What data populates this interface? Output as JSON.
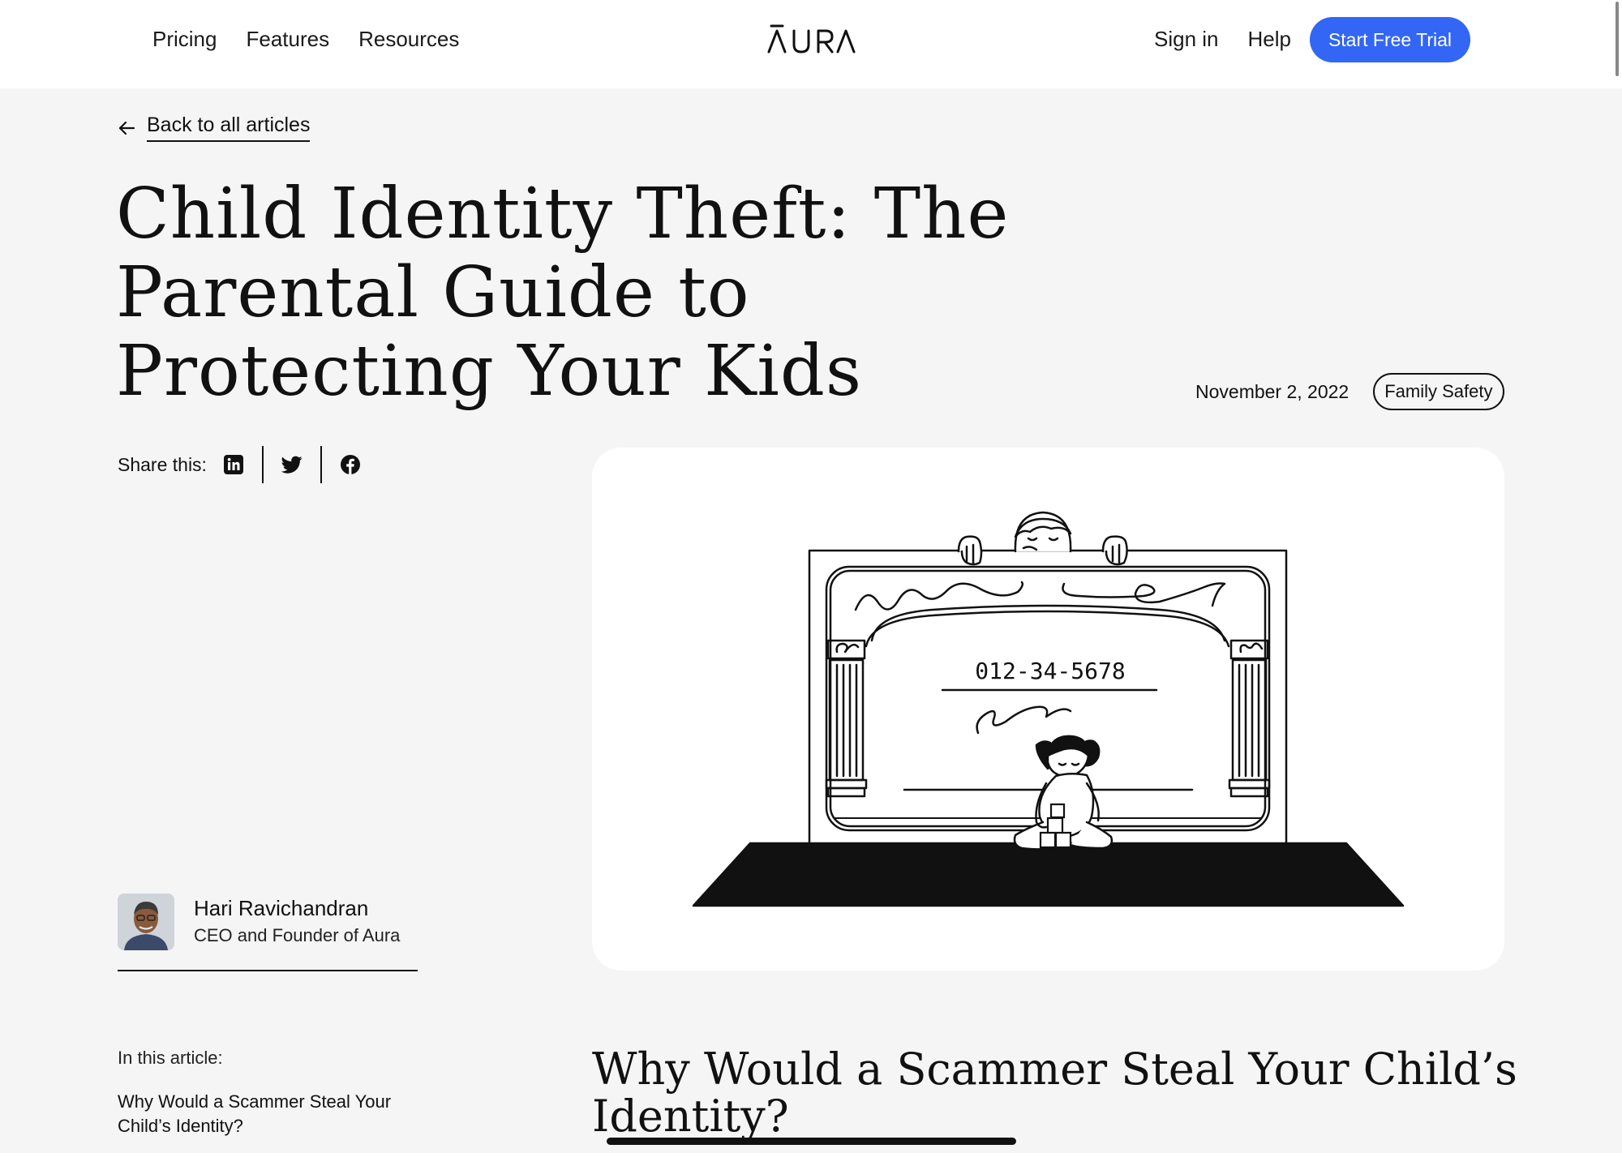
{
  "header": {
    "nav_left": [
      "Pricing",
      "Features",
      "Resources"
    ],
    "logo_text": "AURA",
    "nav_right": [
      "Sign in",
      "Help"
    ],
    "cta_label": "Start Free Trial"
  },
  "back_link": {
    "label": "Back to all articles"
  },
  "article": {
    "title": "Child Identity Theft: The Parental Guide to Protecting Your Kids",
    "date": "November 2, 2022",
    "tag": "Family Safety"
  },
  "share": {
    "label": "Share this:",
    "icons": [
      "linkedin-icon",
      "twitter-icon",
      "facebook-icon"
    ]
  },
  "hero": {
    "card_number": "012-34-5678"
  },
  "author": {
    "name": "Hari Ravichandran",
    "role": "CEO and Founder of Aura"
  },
  "toc": {
    "label": "In this article:",
    "items": [
      "Why Would a Scammer Steal Your Child’s Identity?"
    ]
  },
  "section": {
    "heading": "Why Would a Scammer Steal Your Child’s Identity?"
  },
  "colors": {
    "accent": "#3366f5",
    "background": "#f5f5f5",
    "text": "#111111"
  }
}
